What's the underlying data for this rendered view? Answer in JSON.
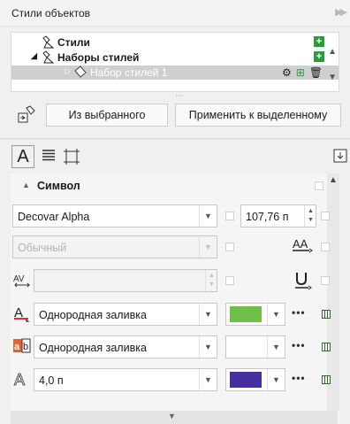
{
  "window": {
    "title": "Стили объектов"
  },
  "tree": {
    "items": [
      {
        "label": "Стили"
      },
      {
        "label": "Наборы стилей"
      },
      {
        "label": "Набор стилей 1"
      }
    ]
  },
  "actions": {
    "from_selection": "Из выбранного",
    "apply_to_selection": "Применить к выделенному"
  },
  "section": {
    "title": "Символ"
  },
  "font": {
    "family": "Decovar Alpha",
    "size": "107,76 п",
    "style_placeholder": "Обычный"
  },
  "fill": {
    "text_fill_label": "Однородная заливка",
    "text_fill_color": "#6fc04a",
    "background_fill_label": "Однородная заливка",
    "background_fill_color": "#ffffff",
    "outline_width": "4,0 п",
    "outline_color": "#4630a0"
  },
  "colors": {
    "plus": "#2a9d3a",
    "selected_row": "#cfcfcf"
  }
}
